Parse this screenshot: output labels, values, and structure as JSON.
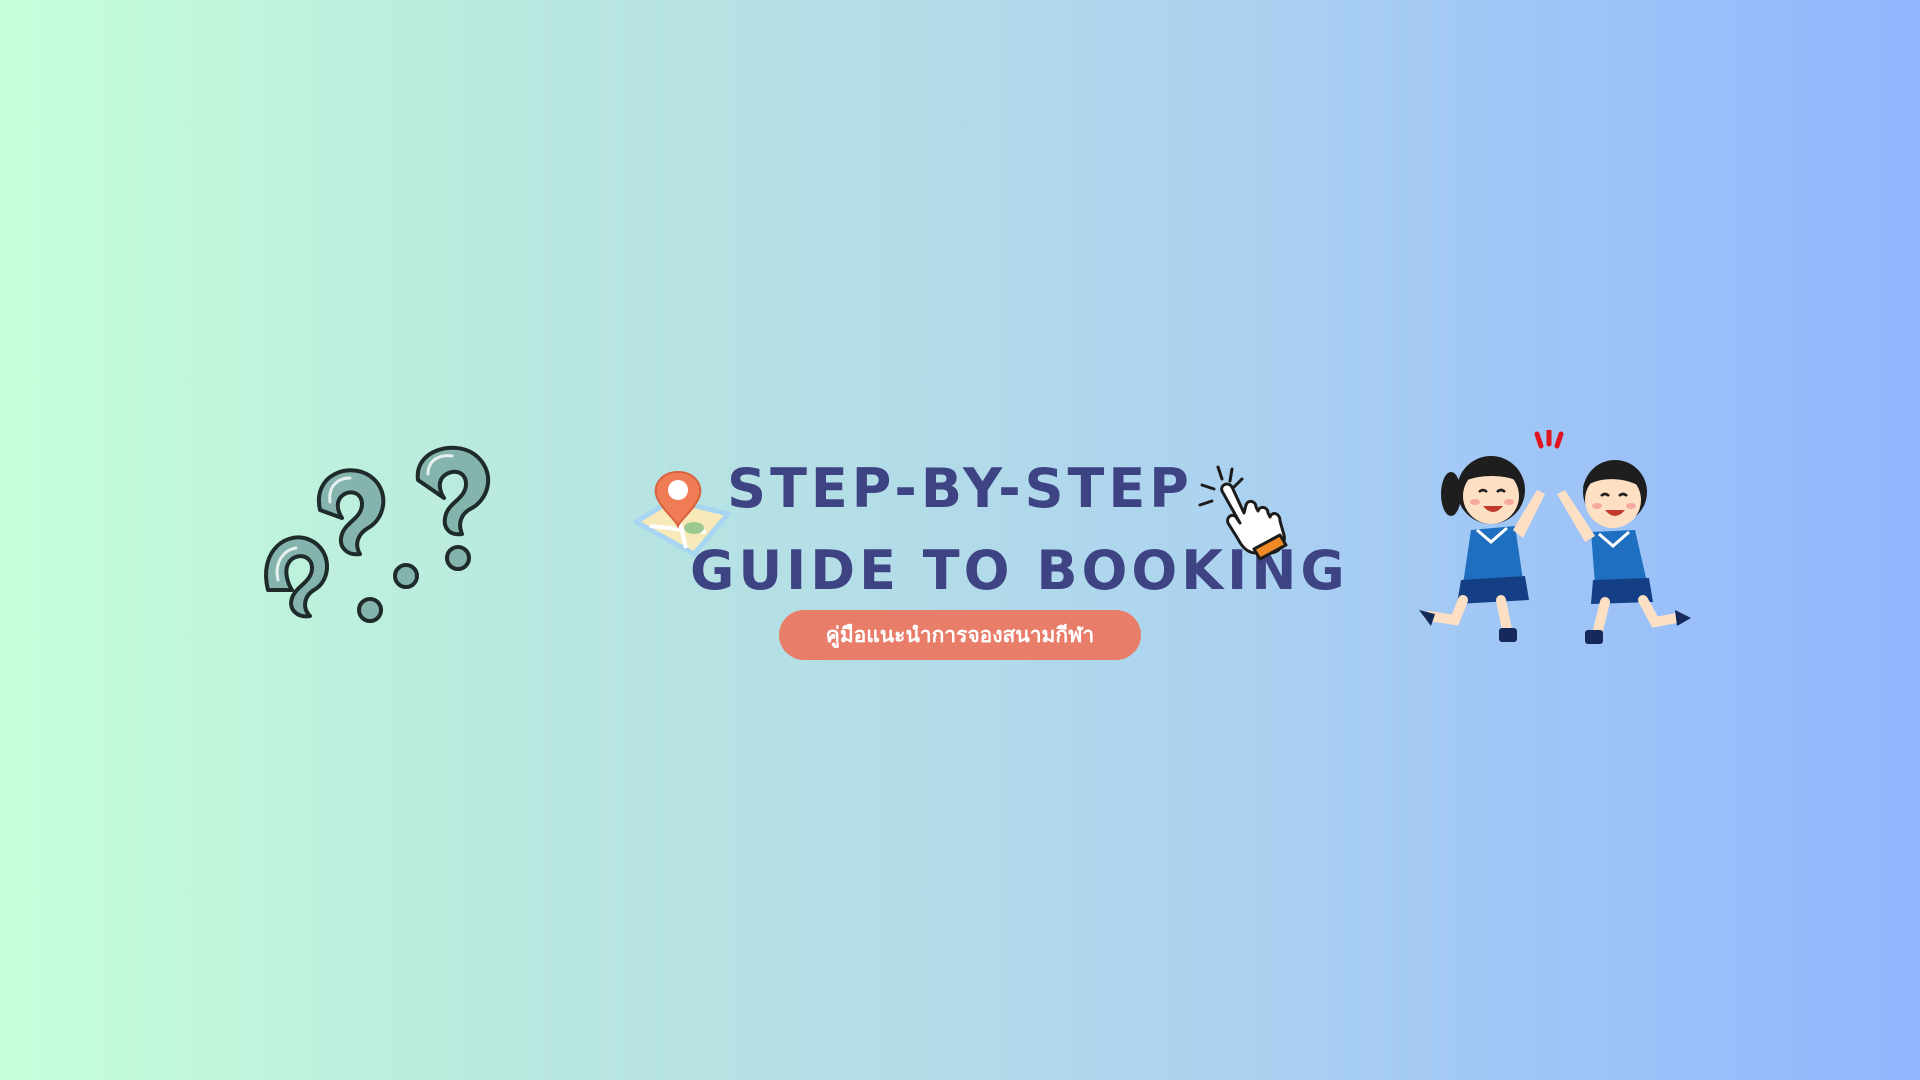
{
  "banner": {
    "title_line_1": "STEP-BY-STEP",
    "title_line_2": "GUIDE TO BOOKING",
    "subtitle": "คู่มือแนะนำการจองสนามกีฬา"
  },
  "icons": {
    "question_marks": "question-marks-icon",
    "map_pin": "map-pin-icon",
    "pointer": "pointing-hand-icon",
    "high_five": "high-five-kids-illustration"
  },
  "colors": {
    "gradient_start": "#c6ffd9",
    "gradient_end": "#91b6ff",
    "title_text": "#3e4383",
    "pill_background": "#e87d69",
    "pill_text": "#ffffff"
  }
}
